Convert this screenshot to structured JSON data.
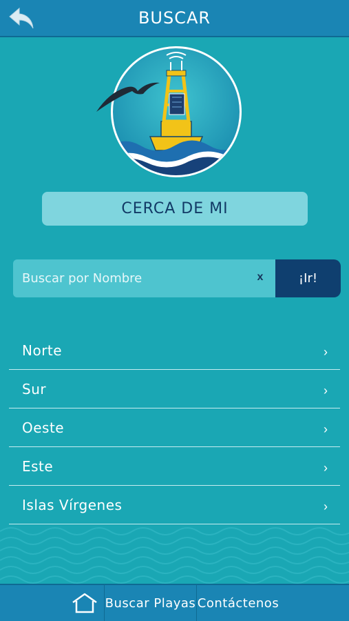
{
  "header": {
    "title": "BUSCAR",
    "back_icon": "back-arrow-icon"
  },
  "near_button": {
    "label": "CERCA DE MI"
  },
  "search": {
    "placeholder": "Buscar por Nombre",
    "value": "",
    "clear_label": "x",
    "go_label": "¡Ir!"
  },
  "regions": [
    {
      "label": "Norte"
    },
    {
      "label": "Sur"
    },
    {
      "label": "Oeste"
    },
    {
      "label": "Este"
    },
    {
      "label": "Islas Vírgenes"
    }
  ],
  "chevron": "›",
  "bottom_nav": {
    "home_icon": "home-icon",
    "items": [
      {
        "label": "Buscar Playas"
      },
      {
        "label": "Contáctenos"
      }
    ]
  },
  "colors": {
    "background": "#1aa7b4",
    "header": "#1a85b4",
    "near_button": "#7fd5de",
    "go_button": "#0f3f6f",
    "buoy_yellow": "#f2c318"
  }
}
